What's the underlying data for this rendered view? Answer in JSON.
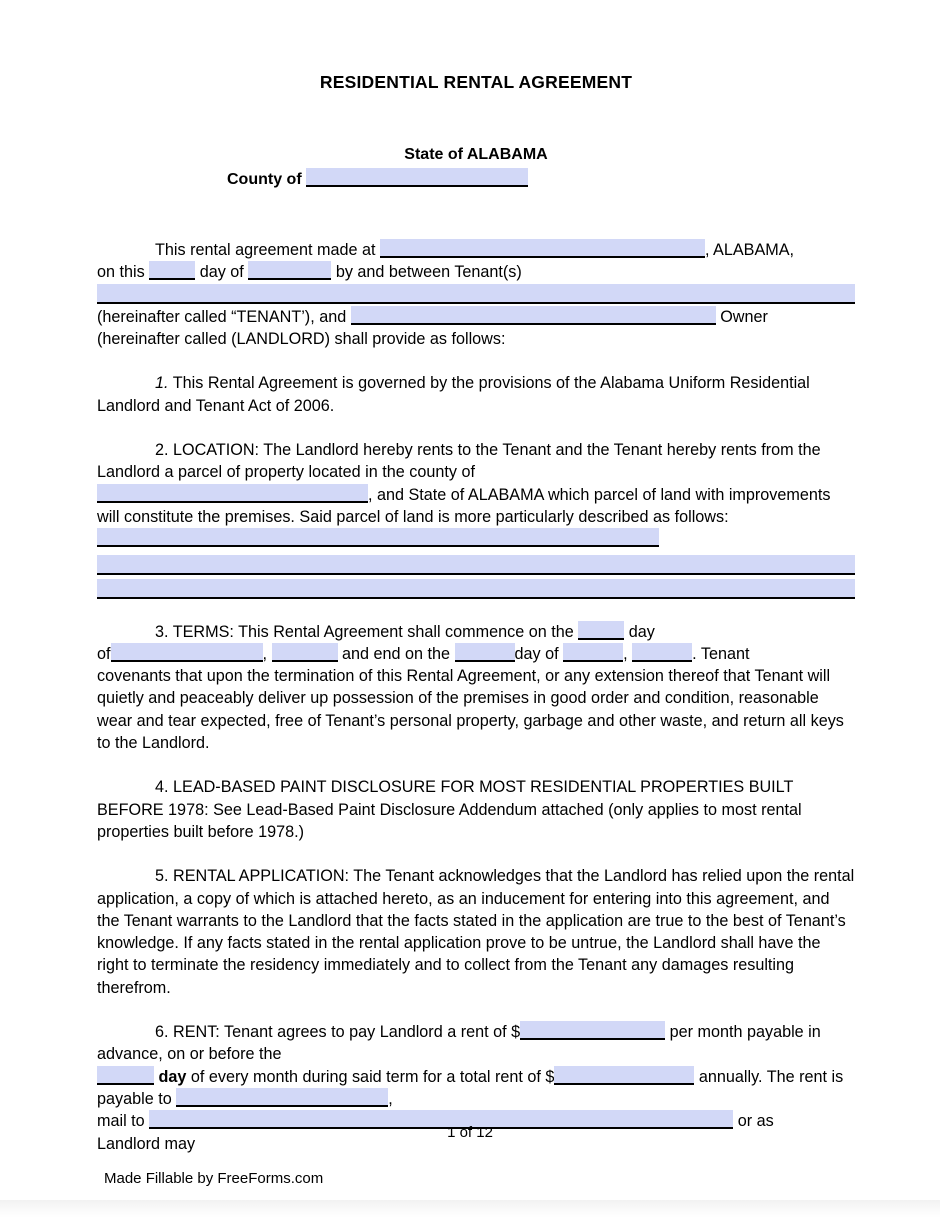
{
  "document": {
    "title": "RESIDENTIAL RENTAL AGREEMENT",
    "state_line": "State of ALABAMA",
    "county_label": "County of",
    "page_number": "1 of 12",
    "made_by": "Made Fillable by FreeForms.com",
    "field_fill_color": "#d2d8f7",
    "field_underline_color": "#000000"
  },
  "intro": {
    "line1_a": "This rental agreement made at",
    "line1_b": ", ALABAMA,",
    "line2_a": "on this",
    "line2_b": "day of",
    "line2_c": "by and between  Tenant(s)",
    "line3_a": "(hereinafter called “TENANT’), and",
    "line3_b": "Owner",
    "line4": "(hereinafter called (LANDLORD) shall provide as follows:"
  },
  "clauses": {
    "c1": {
      "number": "1.",
      "text": "This Rental Agreement is governed by the provisions of the Alabama Uniform Residential Landlord and Tenant Act of 2006."
    },
    "c2": {
      "number": "2.",
      "heading": "LOCATION:",
      "text_a": "The Landlord hereby rents to the Tenant and the Tenant hereby rents from the Landlord a parcel of property located in the county of",
      "text_b": ", and State of ALABAMA which parcel of land with improvements will constitute the premises. Said parcel of land is more particularly described as follows:"
    },
    "c3": {
      "number": "3.",
      "heading": "TERMS:",
      "text_a": "This Rental Agreement shall commence on the",
      "text_b": "day",
      "text_c": "of",
      "text_d": ",",
      "text_e": "and end on the",
      "text_f": "day of",
      "text_g": ",",
      "text_h": ". Tenant",
      "text_i": "covenants that upon the termination of this Rental Agreement, or any extension thereof that Tenant will quietly and peaceably deliver up possession of the premises in good order and condition, reasonable wear and tear expected, free of Tenant’s personal property, garbage and other waste, and return all keys to the Landlord."
    },
    "c4": {
      "number": "4.",
      "heading": "LEAD-BASED PAINT DISCLOSURE FOR MOST RESIDENTIAL PROPERTIES BUILT BEFORE 1978:",
      "text": "See Lead-Based Paint Disclosure Addendum attached (only applies to most rental properties built before 1978.)"
    },
    "c5": {
      "number": "5.",
      "heading": "RENTAL APPLICATION:",
      "text": "The Tenant acknowledges that the Landlord has relied upon the rental application, a copy of which is attached hereto, as an inducement for entering into this agreement, and the Tenant warrants to the Landlord that the facts stated in the application are true to the best of Tenant’s knowledge. If any facts stated in the rental application prove to be untrue, the Landlord shall have the right to terminate the residency immediately and to collect from the Tenant any damages resulting therefrom."
    },
    "c6": {
      "number": "6.",
      "heading": "RENT:",
      "text_a": "Tenant agrees to pay Landlord a rent of  $",
      "text_b": "per month payable in advance, on or before the",
      "text_c": "day",
      "text_d": "of every month during said term for a total rent of $",
      "text_e": "annually. The rent is payable to",
      "text_f": ",",
      "text_g": "mail to",
      "text_h": "or as",
      "text_i": "Landlord may"
    }
  },
  "fields": {
    "county": "",
    "made_at": "",
    "day": "",
    "month": "",
    "tenants": "",
    "owner": "",
    "location_county": "",
    "description_1": "",
    "description_2": "",
    "description_3": "",
    "term_start_day": "",
    "term_start_month": "",
    "term_start_year": "",
    "term_end_day": "",
    "term_end_month": "",
    "term_end_year": "",
    "rent_amount": "",
    "rent_due_day": "",
    "total_rent": "",
    "payable_to": "",
    "mail_to": ""
  }
}
